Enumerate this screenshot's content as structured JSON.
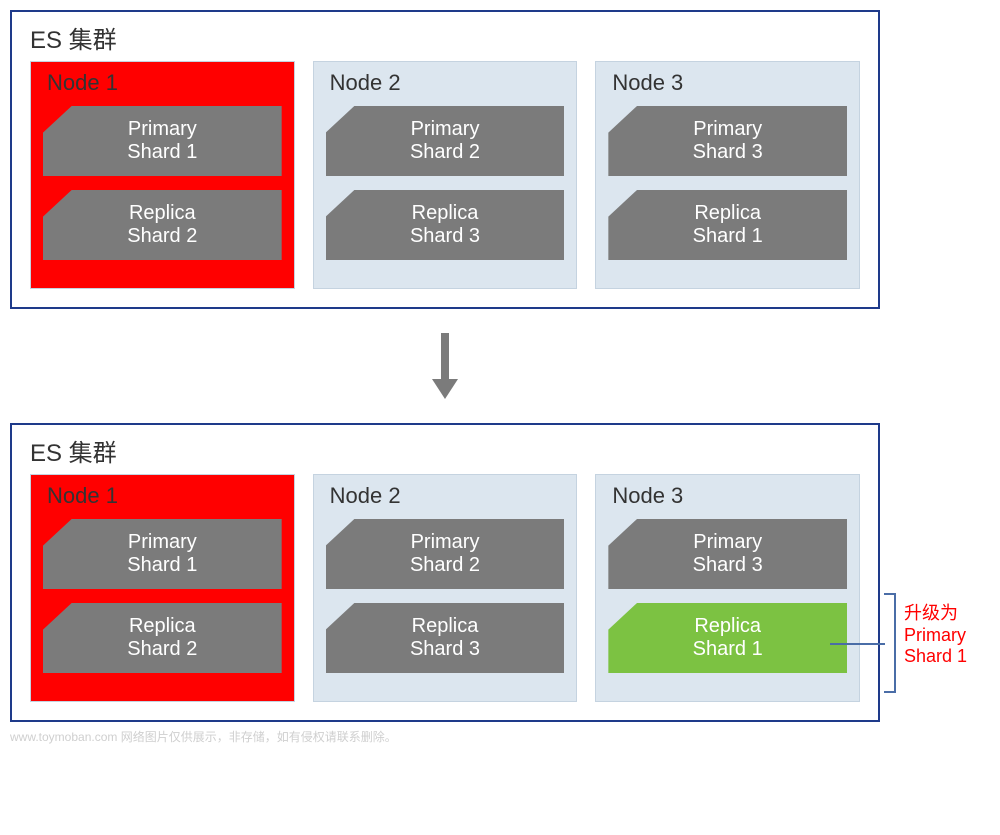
{
  "clusterTitle": "ES 集群",
  "stages": [
    {
      "nodes": [
        {
          "name": "Node 1",
          "failed": true,
          "shards": [
            {
              "line1": "Primary",
              "line2": "Shard 1",
              "green": false
            },
            {
              "line1": "Replica",
              "line2": "Shard 2",
              "green": false
            }
          ]
        },
        {
          "name": "Node 2",
          "failed": false,
          "shards": [
            {
              "line1": "Primary",
              "line2": "Shard 2",
              "green": false
            },
            {
              "line1": "Replica",
              "line2": "Shard 3",
              "green": false
            }
          ]
        },
        {
          "name": "Node 3",
          "failed": false,
          "shards": [
            {
              "line1": "Primary",
              "line2": "Shard 3",
              "green": false
            },
            {
              "line1": "Replica",
              "line2": "Shard 1",
              "green": false
            }
          ]
        }
      ]
    },
    {
      "nodes": [
        {
          "name": "Node 1",
          "failed": true,
          "shards": [
            {
              "line1": "Primary",
              "line2": "Shard 1",
              "green": false
            },
            {
              "line1": "Replica",
              "line2": "Shard 2",
              "green": false
            }
          ]
        },
        {
          "name": "Node 2",
          "failed": false,
          "shards": [
            {
              "line1": "Primary",
              "line2": "Shard 2",
              "green": false
            },
            {
              "line1": "Replica",
              "line2": "Shard 3",
              "green": false
            }
          ]
        },
        {
          "name": "Node 3",
          "failed": false,
          "shards": [
            {
              "line1": "Primary",
              "line2": "Shard 3",
              "green": false
            },
            {
              "line1": "Replica",
              "line2": "Shard 1",
              "green": true
            }
          ]
        }
      ]
    }
  ],
  "annotation": {
    "line1": "升级为",
    "line2": "Primary",
    "line3": "Shard 1"
  },
  "watermark": "www.toymoban.com 网络图片仅供展示，非存储，如有侵权请联系删除。"
}
